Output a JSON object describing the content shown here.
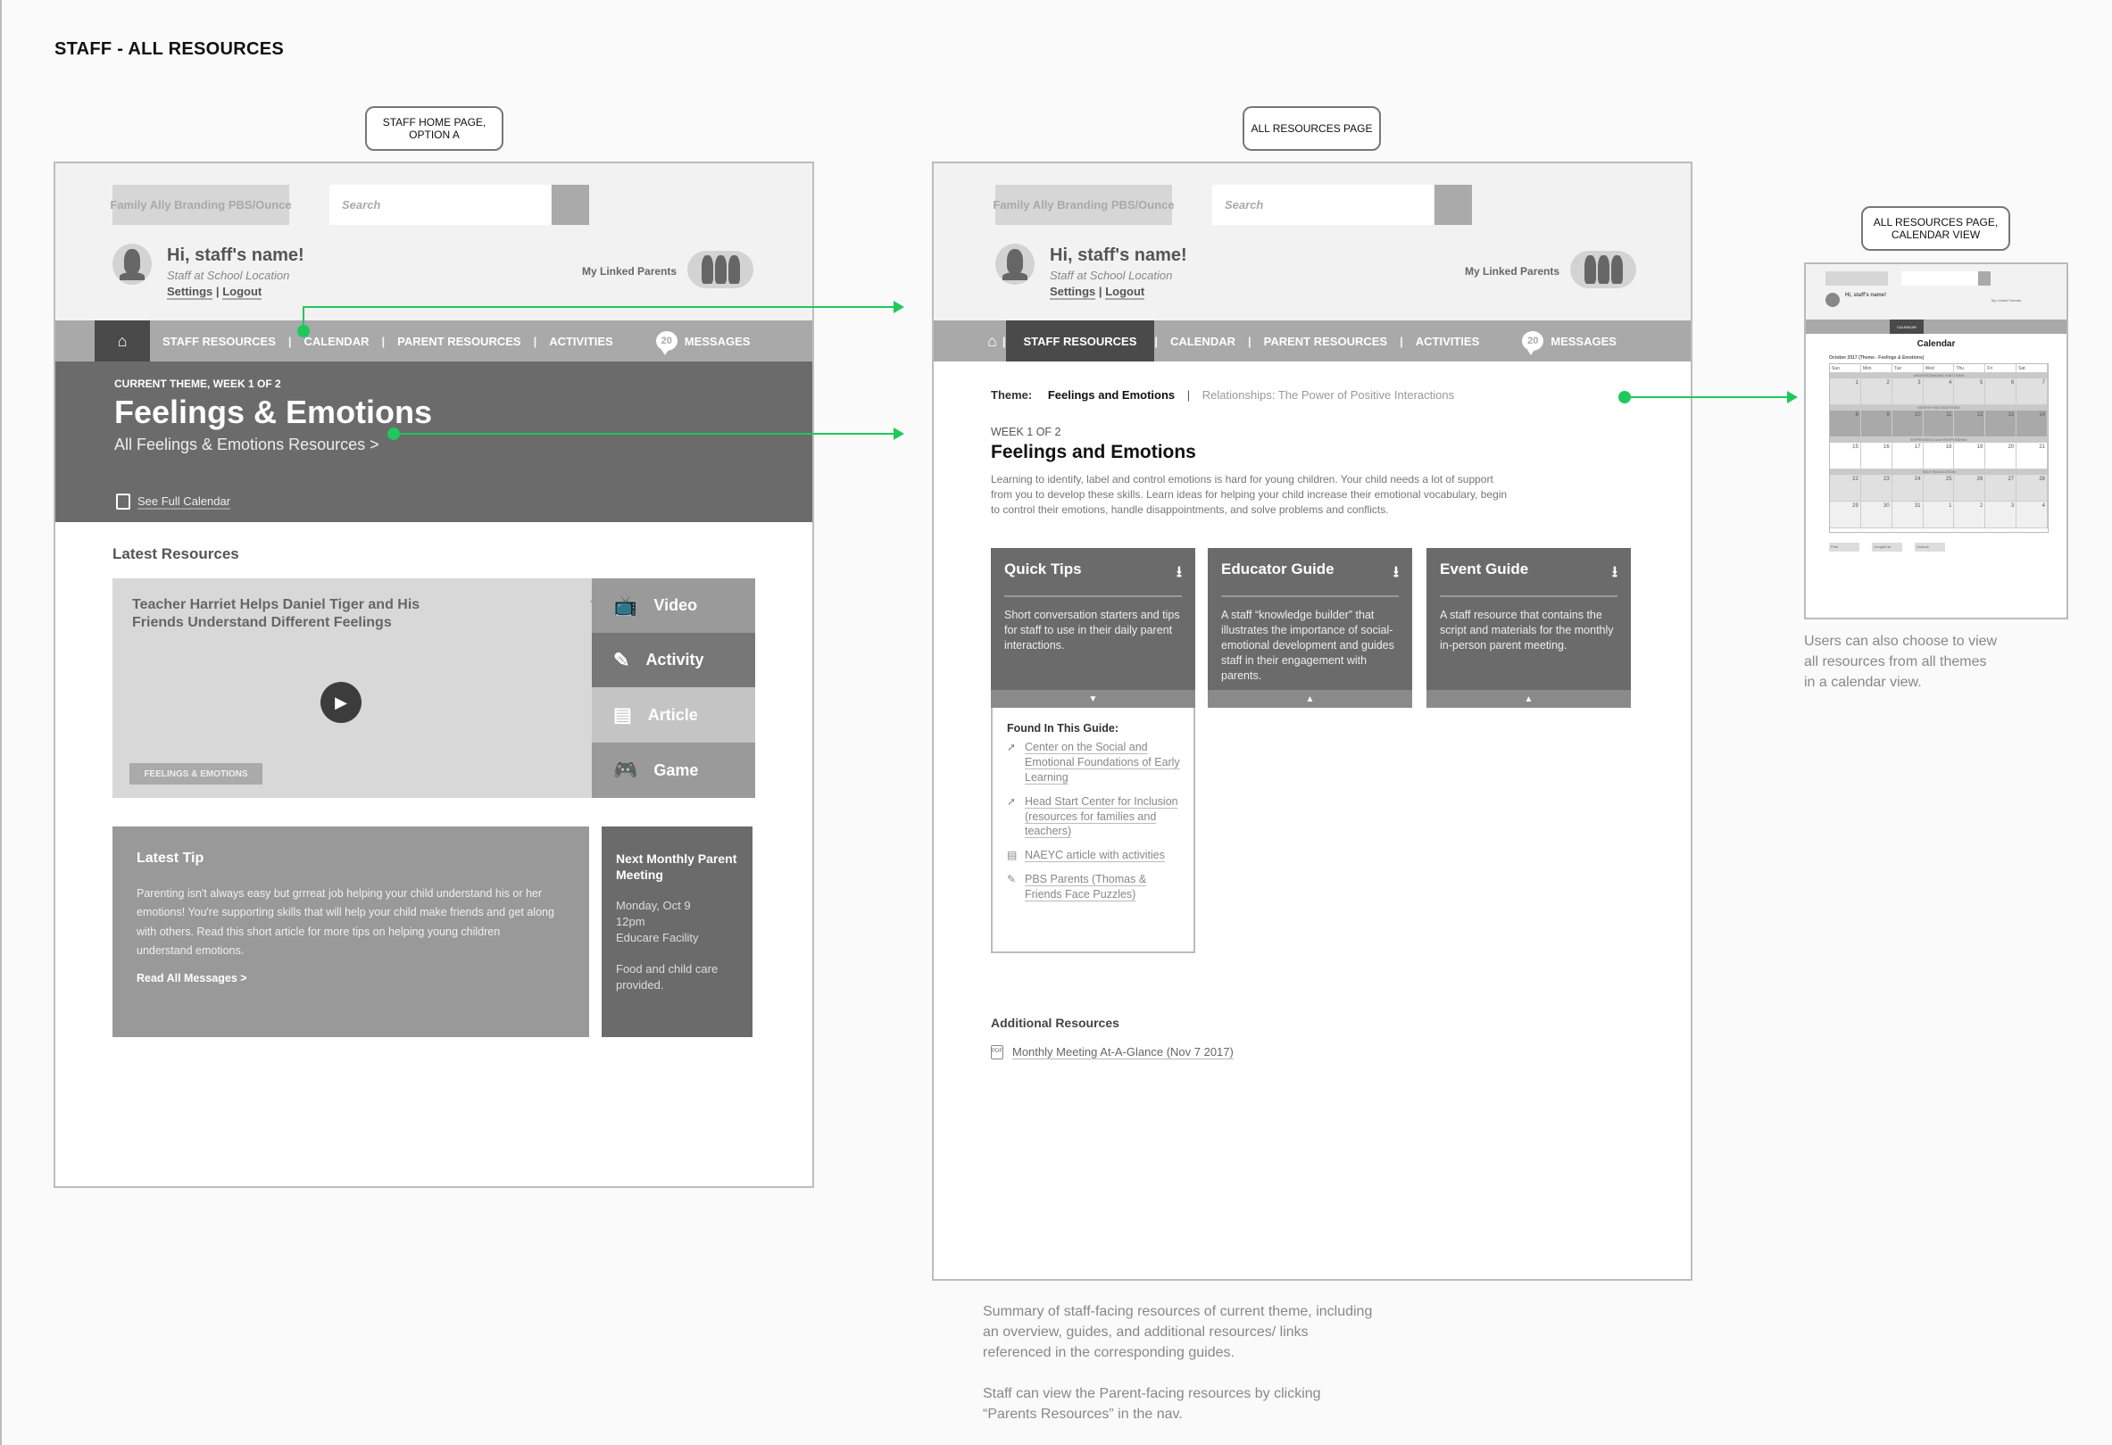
{
  "document_title": "STAFF - ALL RESOURCES",
  "callouts": {
    "home": "STAFF HOME PAGE, OPTION A",
    "all_resources": "ALL RESOURCES PAGE",
    "calendar_view": "ALL RESOURCES PAGE, CALENDAR VIEW"
  },
  "colors": {
    "connector": "#1fc85a",
    "nav_bg": "#a9a9a9",
    "nav_active": "#4a4a4a",
    "hero_bg": "#6b6b6b"
  },
  "header": {
    "brand": "Family Ally Branding PBS/Ounce",
    "search_placeholder": "Search",
    "greeting": "Hi, staff's name!",
    "role": "Staff at School Location",
    "settings": "Settings",
    "divider": "|",
    "logout": "Logout",
    "linked_parents": "My Linked Parents"
  },
  "nav": {
    "home_icon": "home-icon",
    "items": [
      "STAFF RESOURCES",
      "CALENDAR",
      "PARENT RESOURCES",
      "ACTIVITIES"
    ],
    "messages_count": "20",
    "messages": "MESSAGES"
  },
  "home_page": {
    "hero": {
      "eyebrow": "CURRENT THEME, WEEK 1 OF 2",
      "title": "Feelings & Emotions",
      "link": "All Feelings & Emotions Resources  >",
      "calendar_link": "See Full Calendar"
    },
    "latest_resources": {
      "heading": "Latest Resources",
      "feature_title": "Teacher Harriet Helps Daniel Tiger and His Friends Understand Different Feelings",
      "tag": "FEELINGS & EMOTIONS",
      "types": [
        {
          "label": "Video",
          "icon": "tv-icon"
        },
        {
          "label": "Activity",
          "icon": "crayon-icon"
        },
        {
          "label": "Article",
          "icon": "article-icon"
        },
        {
          "label": "Game",
          "icon": "gamepad-icon"
        }
      ]
    },
    "latest_tip": {
      "heading": "Latest Tip",
      "body": "Parenting isn't always easy but grrreat job helping your child understand his or her emotions! You're supporting skills that will help your child make friends and get along with others. Read this short article for more tips on helping young children understand emotions.",
      "link": "Read All Messages >"
    },
    "meeting": {
      "heading": "Next Monthly Parent Meeting",
      "date": "Monday, Oct 9",
      "time": "12pm",
      "place": "Educare Facility",
      "note": "Food and child care provided."
    }
  },
  "resources_page": {
    "theme_label": "Theme:",
    "theme_current": "Feelings and Emotions",
    "theme_sep": "|",
    "theme_next": "Relationships: The Power of Positive Interactions",
    "week": "WEEK 1 OF 2",
    "title": "Feelings and Emotions",
    "description": "Learning to identify, label and control emotions is hard for young children. Your child needs a lot of support from you to develop these skills. Learn ideas for helping your child increase their emotional vocabulary, begin to control their emotions, handle disappointments, and solve problems and conflicts.",
    "cards": [
      {
        "title": "Quick Tips",
        "body": "Short conversation starters and tips for staff to use in their daily parent interactions.",
        "toggle": "▼"
      },
      {
        "title": "Educator Guide",
        "body": "A staff “knowledge builder” that illustrates the importance of social-emotional development and guides staff in their engagement with parents.",
        "toggle": "▲"
      },
      {
        "title": "Event Guide",
        "body": "A staff resource that contains the script and materials for the monthly in-person parent meeting.",
        "toggle": "▲"
      }
    ],
    "guide_panel": {
      "title": "Found In This Guide:",
      "items": [
        {
          "icon": "cursor-icon",
          "text": "Center on the Social and Emotional Foundations of Early Learning"
        },
        {
          "icon": "cursor-icon",
          "text": "Head Start Center for Inclusion (resources for families and teachers)"
        },
        {
          "icon": "article-icon",
          "text": "NAEYC article with activities"
        },
        {
          "icon": "crayon-icon",
          "text": "PBS Parents (Thomas & Friends Face Puzzles)"
        }
      ]
    },
    "additional": {
      "heading": "Additional Resources",
      "items": [
        {
          "icon": "pdf-icon",
          "text": "Monthly Meeting At-A-Glance (Nov 7 2017)"
        }
      ]
    }
  },
  "calendar_thumb": {
    "title": "Calendar",
    "month": "October 2017 (Theme - Feelings & Emotions)",
    "days": [
      "Sun",
      "Mon",
      "Tue",
      "Wed",
      "Thu",
      "Fri",
      "Sat"
    ],
    "weeks": [
      {
        "band": "UNDERSTANDING EMOTIONS",
        "dates": [
          "1",
          "2",
          "3",
          "4",
          "5",
          "6",
          "7"
        ]
      },
      {
        "band": "IDENTIFYING EMOTIONS",
        "dates": [
          "8",
          "9",
          "10",
          "11",
          "12",
          "13",
          "14"
        ]
      },
      {
        "band": "EXPRESSING AND RESPONDING",
        "dates": [
          "15",
          "16",
          "17",
          "18",
          "19",
          "20",
          "21"
        ]
      },
      {
        "band": "SELF-REGULATION",
        "dates": [
          "22",
          "23",
          "24",
          "25",
          "26",
          "27",
          "28"
        ]
      },
      {
        "band": "",
        "dates": [
          "29",
          "30",
          "31",
          "1",
          "2",
          "3",
          "4"
        ]
      }
    ],
    "buttons": [
      "Print",
      "GoogleCal",
      "Outlook"
    ]
  },
  "notes": {
    "resources_1": "Summary of staff-facing resources of current theme, including an overview, guides, and additional resources/ links referenced in the corresponding guides.",
    "resources_2": "Staff can view the Parent-facing resources by clicking “Parents Resources” in the nav.",
    "calendar": "Users can also choose to view all resources from all themes in a calendar view."
  }
}
